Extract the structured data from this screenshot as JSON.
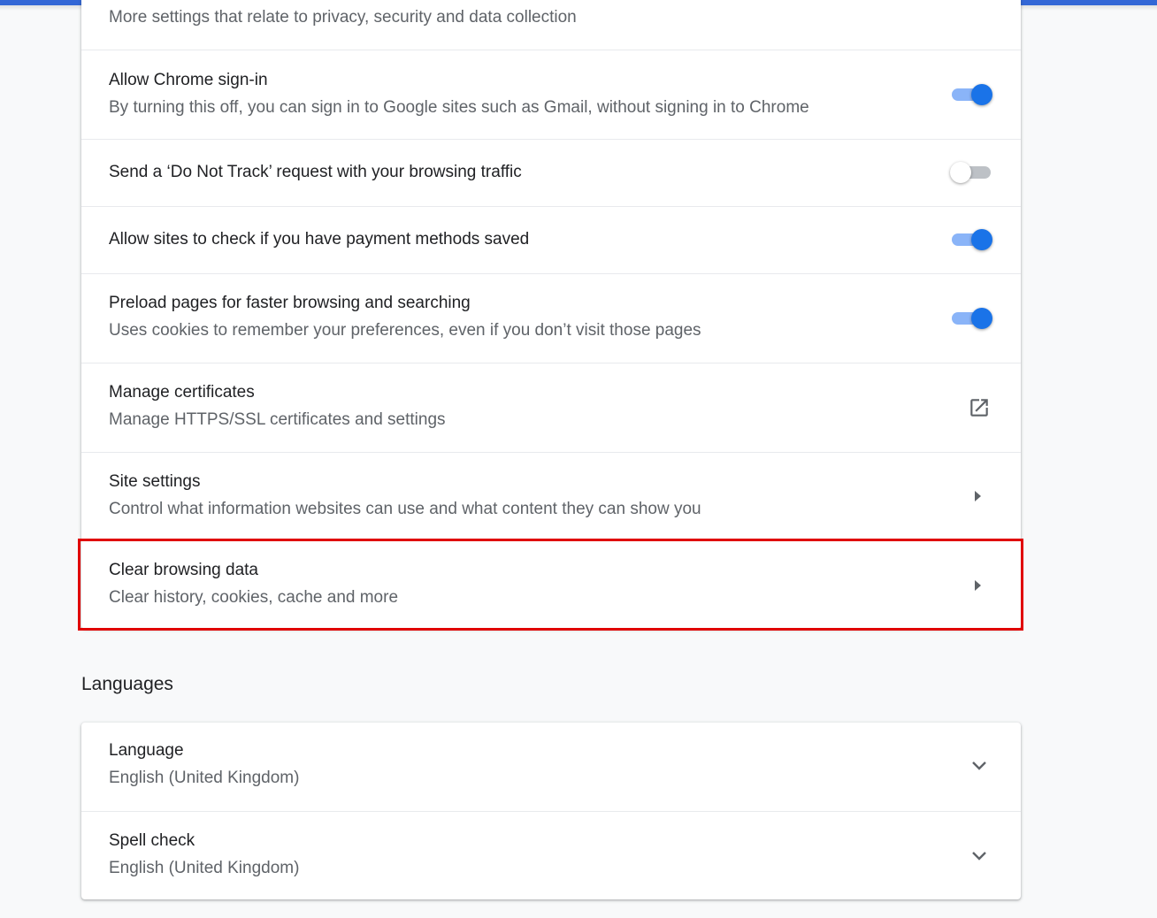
{
  "privacy": {
    "more_settings_sub": "More settings that relate to privacy, security and data collection",
    "rows": [
      {
        "title": "Allow Chrome sign-in",
        "sub": "By turning this off, you can sign in to Google sites such as Gmail, without signing in to Chrome",
        "toggle": true
      },
      {
        "title": "Send a ‘Do Not Track’ request with your browsing traffic",
        "toggle": false
      },
      {
        "title": "Allow sites to check if you have payment methods saved",
        "toggle": true
      },
      {
        "title": "Preload pages for faster browsing and searching",
        "sub": "Uses cookies to remember your preferences, even if you don’t visit those pages",
        "toggle": true
      },
      {
        "title": "Manage certificates",
        "sub": "Manage HTTPS/SSL certificates and settings",
        "icon": "external-link-icon"
      },
      {
        "title": "Site settings",
        "sub": "Control what information websites can use and what content they can show you",
        "icon": "arrow-right-icon"
      },
      {
        "title": "Clear browsing data",
        "sub": "Clear history, cookies, cache and more",
        "icon": "arrow-right-icon"
      }
    ]
  },
  "languages": {
    "section_title": "Languages",
    "rows": [
      {
        "title": "Language",
        "sub": "English (United Kingdom)",
        "icon": "chevron-down-icon"
      },
      {
        "title": "Spell check",
        "sub": "English (United Kingdom)",
        "icon": "chevron-down-icon"
      }
    ]
  },
  "colors": {
    "accent": "#1a73e8",
    "toggle_track_on": "#8ab4f8",
    "highlight": "#e00000",
    "top_bar": "#3367d6"
  }
}
